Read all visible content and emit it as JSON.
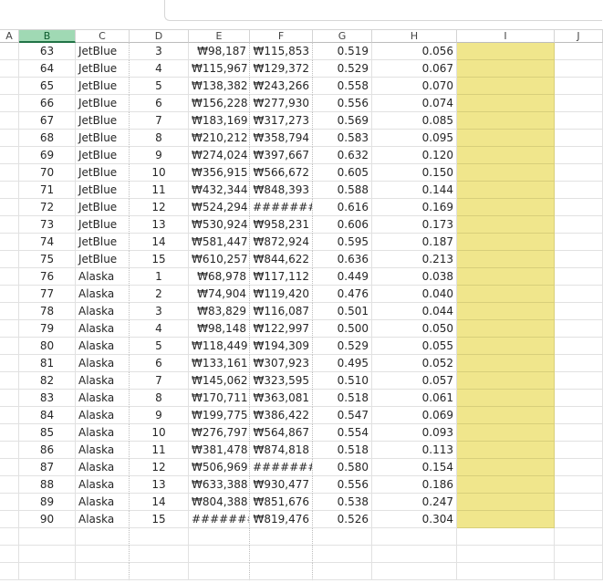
{
  "columns": [
    "A",
    "B",
    "C",
    "D",
    "E",
    "F",
    "G",
    "H",
    "I",
    "J"
  ],
  "selected_column": "B",
  "rows": [
    {
      "b": "63",
      "c": "JetBlue",
      "d": "3",
      "e": "₩98,187",
      "f": "₩115,853",
      "g": "0.519",
      "h": "0.056"
    },
    {
      "b": "64",
      "c": "JetBlue",
      "d": "4",
      "e": "₩115,967",
      "f": "₩129,372",
      "g": "0.529",
      "h": "0.067"
    },
    {
      "b": "65",
      "c": "JetBlue",
      "d": "5",
      "e": "₩138,382",
      "f": "₩243,266",
      "g": "0.558",
      "h": "0.070"
    },
    {
      "b": "66",
      "c": "JetBlue",
      "d": "6",
      "e": "₩156,228",
      "f": "₩277,930",
      "g": "0.556",
      "h": "0.074"
    },
    {
      "b": "67",
      "c": "JetBlue",
      "d": "7",
      "e": "₩183,169",
      "f": "₩317,273",
      "g": "0.569",
      "h": "0.085"
    },
    {
      "b": "68",
      "c": "JetBlue",
      "d": "8",
      "e": "₩210,212",
      "f": "₩358,794",
      "g": "0.583",
      "h": "0.095"
    },
    {
      "b": "69",
      "c": "JetBlue",
      "d": "9",
      "e": "₩274,024",
      "f": "₩397,667",
      "g": "0.632",
      "h": "0.120"
    },
    {
      "b": "70",
      "c": "JetBlue",
      "d": "10",
      "e": "₩356,915",
      "f": "₩566,672",
      "g": "0.605",
      "h": "0.150"
    },
    {
      "b": "71",
      "c": "JetBlue",
      "d": "11",
      "e": "₩432,344",
      "f": "₩848,393",
      "g": "0.588",
      "h": "0.144"
    },
    {
      "b": "72",
      "c": "JetBlue",
      "d": "12",
      "e": "₩524,294",
      "f": "#########",
      "g": "0.616",
      "h": "0.169"
    },
    {
      "b": "73",
      "c": "JetBlue",
      "d": "13",
      "e": "₩530,924",
      "f": "₩958,231",
      "g": "0.606",
      "h": "0.173"
    },
    {
      "b": "74",
      "c": "JetBlue",
      "d": "14",
      "e": "₩581,447",
      "f": "₩872,924",
      "g": "0.595",
      "h": "0.187"
    },
    {
      "b": "75",
      "c": "JetBlue",
      "d": "15",
      "e": "₩610,257",
      "f": "₩844,622",
      "g": "0.636",
      "h": "0.213"
    },
    {
      "b": "76",
      "c": "Alaska",
      "d": "1",
      "e": "₩68,978",
      "f": "₩117,112",
      "g": "0.449",
      "h": "0.038"
    },
    {
      "b": "77",
      "c": "Alaska",
      "d": "2",
      "e": "₩74,904",
      "f": "₩119,420",
      "g": "0.476",
      "h": "0.040"
    },
    {
      "b": "78",
      "c": "Alaska",
      "d": "3",
      "e": "₩83,829",
      "f": "₩116,087",
      "g": "0.501",
      "h": "0.044"
    },
    {
      "b": "79",
      "c": "Alaska",
      "d": "4",
      "e": "₩98,148",
      "f": "₩122,997",
      "g": "0.500",
      "h": "0.050"
    },
    {
      "b": "80",
      "c": "Alaska",
      "d": "5",
      "e": "₩118,449",
      "f": "₩194,309",
      "g": "0.529",
      "h": "0.055"
    },
    {
      "b": "81",
      "c": "Alaska",
      "d": "6",
      "e": "₩133,161",
      "f": "₩307,923",
      "g": "0.495",
      "h": "0.052"
    },
    {
      "b": "82",
      "c": "Alaska",
      "d": "7",
      "e": "₩145,062",
      "f": "₩323,595",
      "g": "0.510",
      "h": "0.057"
    },
    {
      "b": "83",
      "c": "Alaska",
      "d": "8",
      "e": "₩170,711",
      "f": "₩363,081",
      "g": "0.518",
      "h": "0.061"
    },
    {
      "b": "84",
      "c": "Alaska",
      "d": "9",
      "e": "₩199,775",
      "f": "₩386,422",
      "g": "0.547",
      "h": "0.069"
    },
    {
      "b": "85",
      "c": "Alaska",
      "d": "10",
      "e": "₩276,797",
      "f": "₩564,867",
      "g": "0.554",
      "h": "0.093"
    },
    {
      "b": "86",
      "c": "Alaska",
      "d": "11",
      "e": "₩381,478",
      "f": "₩874,818",
      "g": "0.518",
      "h": "0.113"
    },
    {
      "b": "87",
      "c": "Alaska",
      "d": "12",
      "e": "₩506,969",
      "f": "#########",
      "g": "0.580",
      "h": "0.154"
    },
    {
      "b": "88",
      "c": "Alaska",
      "d": "13",
      "e": "₩633,388",
      "f": "₩930,477",
      "g": "0.556",
      "h": "0.186"
    },
    {
      "b": "89",
      "c": "Alaska",
      "d": "14",
      "e": "₩804,388",
      "f": "₩851,676",
      "g": "0.538",
      "h": "0.247"
    },
    {
      "b": "90",
      "c": "Alaska",
      "d": "15",
      "e": "#########",
      "f": "₩819,476",
      "g": "0.526",
      "h": "0.304"
    }
  ],
  "empty_rows": 3,
  "highlight_color": "#f0e68c",
  "selected_header_color": "#a0d9b4"
}
